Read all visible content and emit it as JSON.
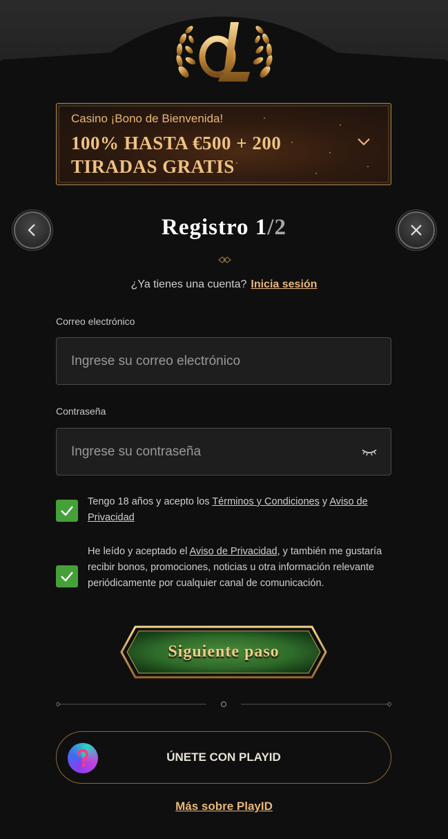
{
  "promo": {
    "subtitle": "Casino ¡Bono de Bienvenida!",
    "title": "100% HASTA €500 + 200 TIRADAS GRATIS"
  },
  "header": {
    "title_main": "Registro 1",
    "title_sep": "/",
    "title_total": "2"
  },
  "account": {
    "prompt": "¿Ya tienes una cuenta?",
    "login_link": "Inicia sesión"
  },
  "form": {
    "email": {
      "label": "Correo electrónico",
      "placeholder": "Ingrese su correo electrónico"
    },
    "password": {
      "label": "Contraseña",
      "placeholder": "Ingrese su contraseña"
    }
  },
  "consents": [
    {
      "checked": true,
      "text_before": "Tengo 18 años y acepto los ",
      "link1": "Términos y Condiciones",
      "text_mid": " y ",
      "link2": "Aviso de Privacidad"
    },
    {
      "checked": true,
      "text_before": "He leído y aceptado el ",
      "link1": "Aviso de Privacidad",
      "text_after": ", y también me gustaría recibir bonos, promociones, noticias u otra información relevante periódicamente por cualquier canal de comunicación."
    }
  ],
  "actions": {
    "next_label": "Siguiente paso",
    "playid_label": "ÚNETE CON PLAYID",
    "more_playid": "Más sobre PlayID"
  },
  "colors": {
    "gold": "#e9b779",
    "panel": "#0f0f0f",
    "check_green": "#46a03a",
    "button_green": "#2f6b2a"
  },
  "icons": {
    "back": "chevron-left-icon",
    "close": "close-icon",
    "expand": "chevron-down-icon",
    "password_toggle": "eye-closed-icon",
    "check": "checkmark-icon"
  }
}
